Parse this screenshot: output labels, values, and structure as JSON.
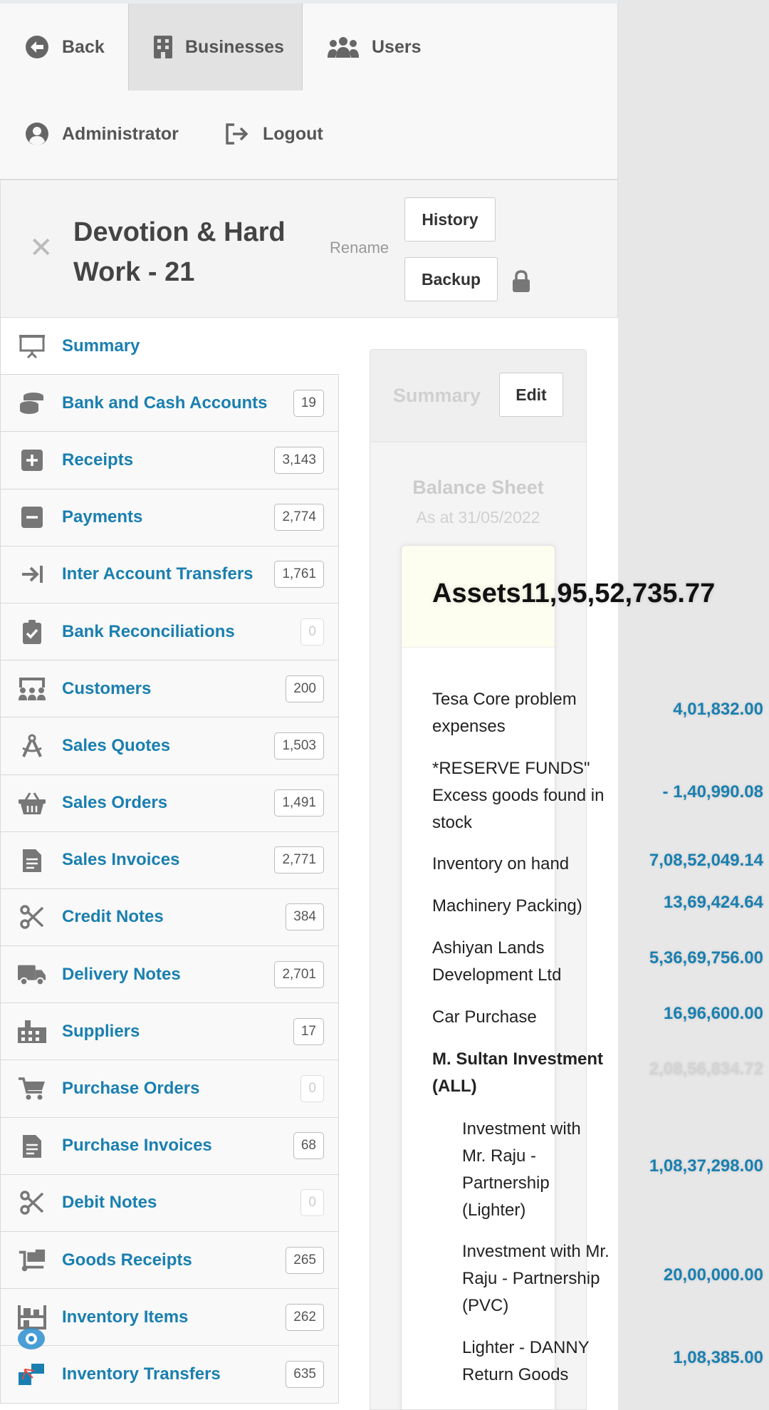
{
  "nav": {
    "back": "Back",
    "businesses": "Businesses",
    "users": "Users",
    "administrator": "Administrator",
    "logout": "Logout"
  },
  "business": {
    "title": "Devotion & Hard Work - 21",
    "rename": "Rename",
    "history": "History",
    "backup": "Backup"
  },
  "sidebar": {
    "items": [
      {
        "label": "Summary",
        "icon": "presentation-icon",
        "count": ""
      },
      {
        "label": "Bank and Cash Accounts",
        "icon": "coins-icon",
        "count": "19"
      },
      {
        "label": "Receipts",
        "icon": "plus-square-icon",
        "count": "3,143"
      },
      {
        "label": "Payments",
        "icon": "minus-square-icon",
        "count": "2,774"
      },
      {
        "label": "Inter Account Transfers",
        "icon": "transfer-arrow-icon",
        "count": "1,761"
      },
      {
        "label": "Bank Reconciliations",
        "icon": "clipboard-check-icon",
        "count": "0"
      },
      {
        "label": "Customers",
        "icon": "customers-icon",
        "count": "200"
      },
      {
        "label": "Sales Quotes",
        "icon": "compass-icon",
        "count": "1,503"
      },
      {
        "label": "Sales Orders",
        "icon": "basket-icon",
        "count": "1,491"
      },
      {
        "label": "Sales Invoices",
        "icon": "invoice-icon",
        "count": "2,771"
      },
      {
        "label": "Credit Notes",
        "icon": "scissors-icon",
        "count": "384"
      },
      {
        "label": "Delivery Notes",
        "icon": "truck-icon",
        "count": "2,701"
      },
      {
        "label": "Suppliers",
        "icon": "industry-icon",
        "count": "17"
      },
      {
        "label": "Purchase Orders",
        "icon": "cart-icon",
        "count": "0"
      },
      {
        "label": "Purchase Invoices",
        "icon": "invoice-icon",
        "count": "68"
      },
      {
        "label": "Debit Notes",
        "icon": "scissors-icon",
        "count": "0"
      },
      {
        "label": "Goods Receipts",
        "icon": "dolly-icon",
        "count": "265"
      },
      {
        "label": "Inventory Items",
        "icon": "shelves-icon",
        "count": "262"
      },
      {
        "label": "Inventory Transfers",
        "icon": "inventory-transfer-icon",
        "count": "635"
      }
    ]
  },
  "summary": {
    "title": "Summary",
    "edit": "Edit",
    "report_title": "Balance Sheet",
    "report_date": "As at 31/05/2022",
    "assets_label": "Assets",
    "assets_total": "11,95,52,735.77",
    "rows": [
      {
        "label": "Tesa Core problem expenses",
        "value": "4,01,832.00"
      },
      {
        "label": "*RESERVE FUNDS\" Excess goods found in stock",
        "value": "- 1,40,990.08"
      },
      {
        "label": "Inventory on hand",
        "value": "7,08,52,049.14"
      },
      {
        "label": "Machinery Packing)",
        "value": "13,69,424.64"
      },
      {
        "label": "Ashiyan Lands Development Ltd",
        "value": "5,36,69,756.00"
      },
      {
        "label": "Car Purchase",
        "value": "16,96,600.00"
      },
      {
        "label": "M. Sultan Investment (ALL)",
        "value": "2,08,56,834.72"
      },
      {
        "label": "Investment with Mr. Raju - Partnership (Lighter)",
        "value": "1,08,37,298.00"
      },
      {
        "label": "Investment with Mr. Raju - Partnership (PVC)",
        "value": "20,00,000.00"
      },
      {
        "label": "Lighter - DANNY Return Goods",
        "value": "1,08,385.00"
      }
    ]
  },
  "colors": {
    "link": "#1a7fb0",
    "badge_border": "#bbbbbb"
  }
}
